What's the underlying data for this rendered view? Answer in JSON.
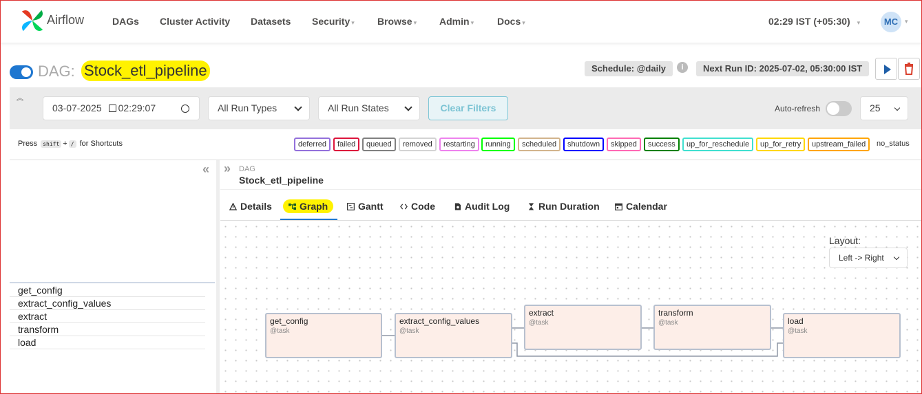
{
  "nav": {
    "brand": "Airflow",
    "items": [
      "DAGs",
      "Cluster Activity",
      "Datasets",
      "Security",
      "Browse",
      "Admin",
      "Docs"
    ],
    "clock": "02:29 IST (+05:30)",
    "avatar": "MC"
  },
  "dag": {
    "prefix": "DAG:",
    "name": "Stock_etl_pipeline",
    "schedule": "Schedule: @daily",
    "next_run": "Next Run ID: 2025-07-02, 05:30:00 IST"
  },
  "filters": {
    "date": "03-07-2025",
    "time": "02:29:07",
    "run_types": "All Run Types",
    "run_states": "All Run States",
    "clear": "Clear Filters",
    "autorefresh": "Auto-refresh",
    "page_size": "25"
  },
  "shortcuts": {
    "press": "Press",
    "key1": "shift",
    "plus": "+",
    "key2": "/",
    "suffix": "for Shortcuts"
  },
  "legend": [
    {
      "label": "deferred",
      "color": "#9370db"
    },
    {
      "label": "failed",
      "color": "#dc143c"
    },
    {
      "label": "queued",
      "color": "#808080"
    },
    {
      "label": "removed",
      "color": "#d3d3d3"
    },
    {
      "label": "restarting",
      "color": "#ee82ee"
    },
    {
      "label": "running",
      "color": "#00ff00"
    },
    {
      "label": "scheduled",
      "color": "#d2b48c"
    },
    {
      "label": "shutdown",
      "color": "#0000ff"
    },
    {
      "label": "skipped",
      "color": "#ff69b4"
    },
    {
      "label": "success",
      "color": "#008000"
    },
    {
      "label": "up_for_reschedule",
      "color": "#40e0d0"
    },
    {
      "label": "up_for_retry",
      "color": "#ffd700"
    },
    {
      "label": "upstream_failed",
      "color": "#ffa500"
    }
  ],
  "legend_no_status": "no_status",
  "tasks": [
    "get_config",
    "extract_config_values",
    "extract",
    "transform",
    "load"
  ],
  "breadcrumb": {
    "label": "DAG",
    "name": "Stock_etl_pipeline"
  },
  "tabs": [
    "Details",
    "Graph",
    "Gantt",
    "Code",
    "Audit Log",
    "Run Duration",
    "Calendar"
  ],
  "layout": {
    "label": "Layout:",
    "value": "Left -> Right"
  },
  "graph": {
    "nodes": [
      {
        "name": "get_config",
        "type": "@task"
      },
      {
        "name": "extract_config_values",
        "type": "@task"
      },
      {
        "name": "extract",
        "type": "@task"
      },
      {
        "name": "transform",
        "type": "@task"
      },
      {
        "name": "load",
        "type": "@task"
      }
    ]
  }
}
